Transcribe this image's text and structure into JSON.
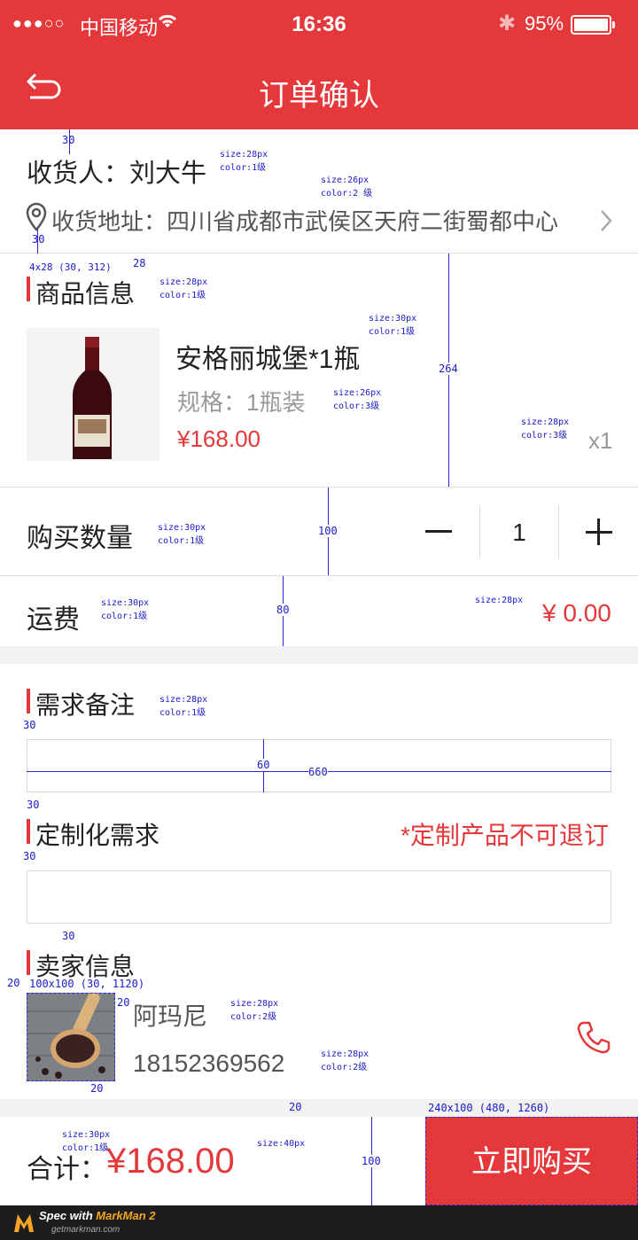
{
  "status_bar": {
    "signal": "●●●○○",
    "carrier": "中国移动",
    "time": "16:36",
    "battery": "95%"
  },
  "nav": {
    "title": "订单确认"
  },
  "consignee": {
    "label": "收货人：刘大牛",
    "address": "收货地址：四川省成都市武侯区天府二街蜀都中心"
  },
  "product": {
    "section_title": "商品信息",
    "name": "安格丽城堡*1瓶",
    "spec": "规格：1瓶装",
    "price": "¥168.00",
    "count": "x1"
  },
  "quantity": {
    "label": "购买数量",
    "minus": "−",
    "value": "1",
    "plus": "+"
  },
  "shipping": {
    "label": "运费",
    "value": "¥ 0.00"
  },
  "notes": {
    "title": "需求备注"
  },
  "custom": {
    "title": "定制化需求",
    "warning": "*定制产品不可退订"
  },
  "seller": {
    "title": "卖家信息",
    "name": "阿玛尼",
    "phone": "18152369562"
  },
  "footer": {
    "total_label": "合计：",
    "total_value": "¥168.00",
    "buy_label": "立即购买"
  },
  "watermark": {
    "line1_a": "Spec with ",
    "line1_b": "MarkMan 2",
    "line2": "getmarkman.com"
  },
  "annotations": {
    "a1": "size:28px\ncolor:1级",
    "a2": "size:26px\ncolor:2 级",
    "a3": "size:28px\ncolor:1级",
    "a4": "size:30px\ncolor:1级",
    "a5": "size:26px\ncolor:3级",
    "a6": "size:28px\ncolor:3级",
    "a7": "size:30px\ncolor:1级",
    "a8": "size:30px\ncolor:1级",
    "a9": "size:28px",
    "a10": "size:28px\ncolor:1级",
    "a11": "size:28px\ncolor:2级",
    "a12": "size:28px\ncolor:2级",
    "a13": "size:30px\ncolor:1级",
    "a14": "size:40px",
    "d30a": "30",
    "d30b": "30",
    "d28": "28",
    "d264": "264",
    "d100a": "100",
    "d80": "80",
    "d30c": "30",
    "d60": "60",
    "d660": "660",
    "d30d": "30",
    "d30e": "30",
    "d30f": "30",
    "d20a": "20",
    "d20b": "20",
    "d20c": "20",
    "d20d": "20",
    "d100b": "100",
    "box1": "4x28 (30, 312)",
    "box2": "100x100 (30, 1120)",
    "box3": "240x100 (480, 1260)"
  },
  "colors": {
    "accent": "#e5383b",
    "text1": "#222222",
    "text2": "#555555",
    "text3": "#999999"
  }
}
